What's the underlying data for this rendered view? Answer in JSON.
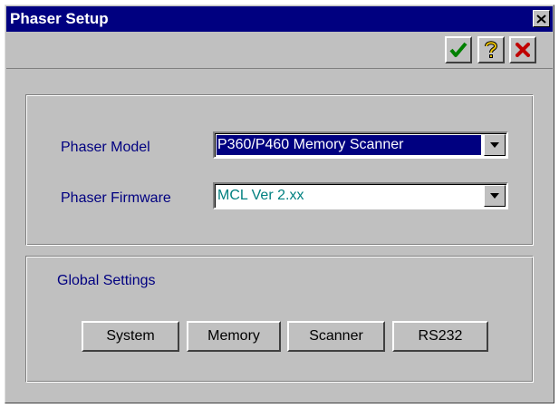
{
  "window": {
    "title": "Phaser Setup"
  },
  "toolbar": {
    "ok_icon": "checkmark-icon",
    "help_icon": "question-mark-icon",
    "cancel_icon": "x-icon"
  },
  "phaser": {
    "model_label": "Phaser Model",
    "model_value": "P360/P460 Memory Scanner",
    "firmware_label": "Phaser Firmware",
    "firmware_value": "MCL Ver 2.xx"
  },
  "global": {
    "title": "Global Settings",
    "buttons": [
      "System",
      "Memory",
      "Scanner",
      "RS232"
    ]
  },
  "colors": {
    "titlebar": "#000080",
    "label": "#000080",
    "firmware_text": "#008080",
    "ok_green": "#008000",
    "help_yellow": "#c8a000",
    "cancel_red": "#c00000"
  }
}
